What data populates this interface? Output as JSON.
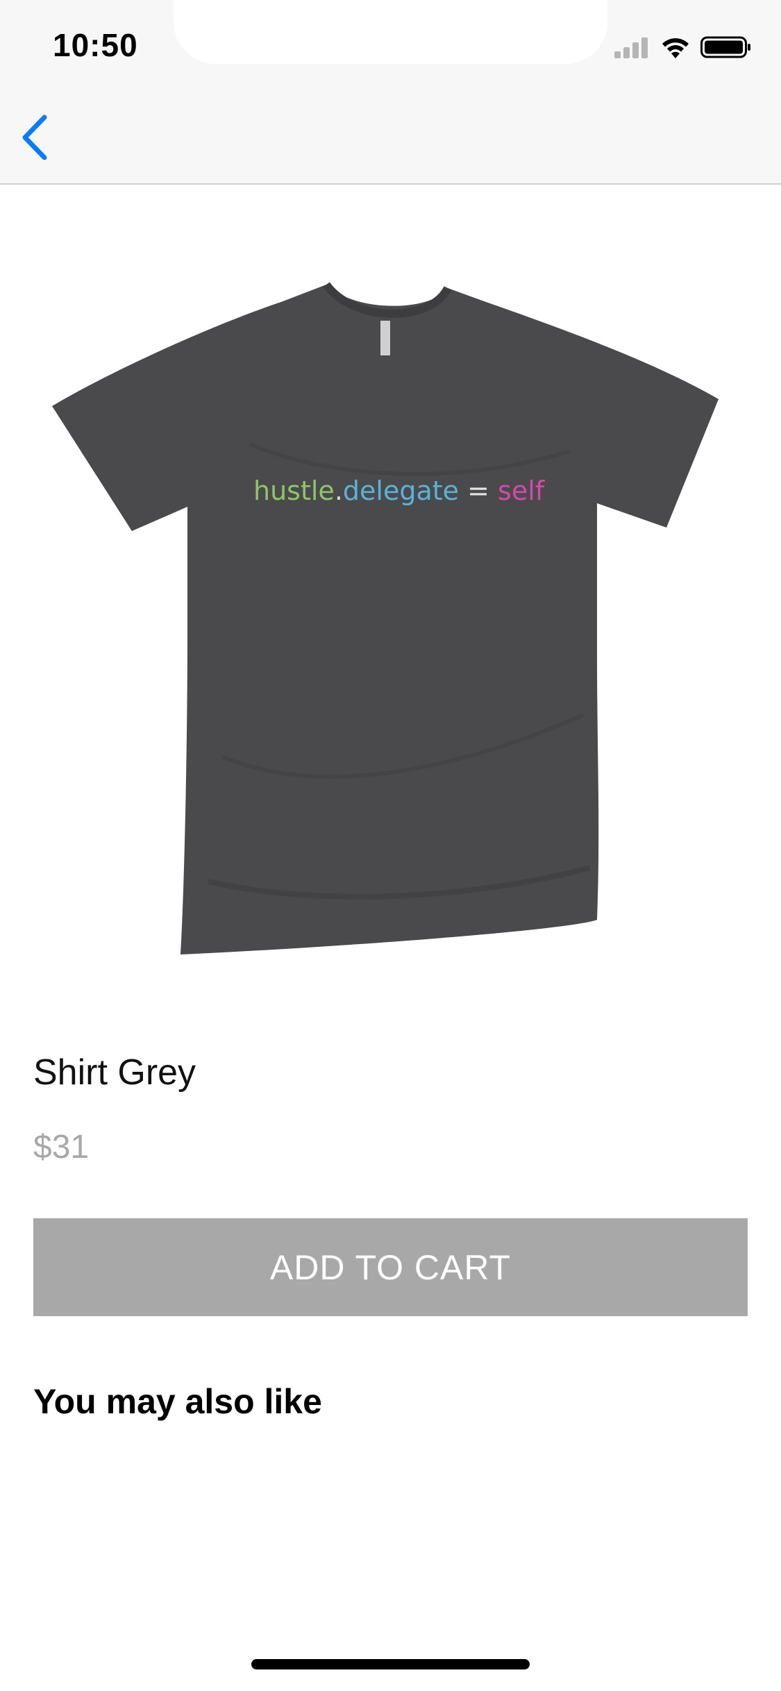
{
  "status_bar": {
    "time": "10:50",
    "icons": [
      "signal-icon",
      "wifi-icon",
      "battery-icon"
    ]
  },
  "nav": {
    "back_icon": "chevron-left-icon",
    "accent_color": "#0a7aff"
  },
  "product": {
    "image_icon": "tshirt-image",
    "shirt_print": {
      "part1": "hustle",
      "dot": ".",
      "part2": "delegate",
      "equals": " = ",
      "part3": "self"
    },
    "title": "Shirt Grey",
    "price": "$31",
    "add_to_cart_label": "ADD TO CART"
  },
  "recommendations": {
    "title": "You may also like"
  },
  "colors": {
    "button_bg": "#a8a8a8",
    "price_text": "#a8a8a8",
    "shirt": "#4a4a4c"
  }
}
